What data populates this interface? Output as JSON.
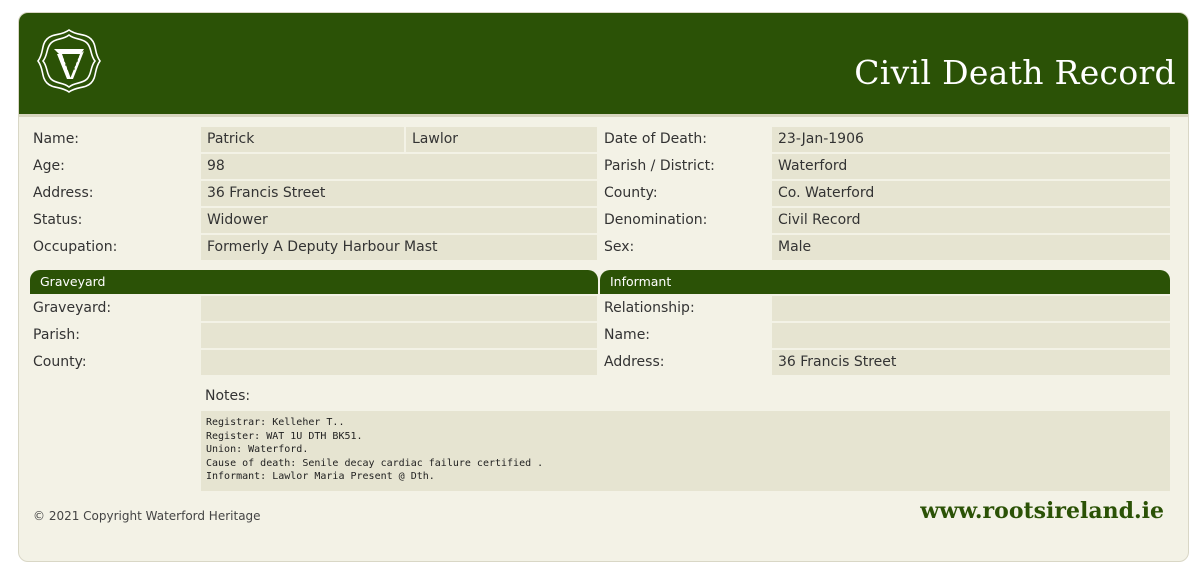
{
  "header": {
    "title": "Civil Death Record",
    "logo_icon": "harp-logo-icon"
  },
  "colors": {
    "brand_green": "#2b5206",
    "cell_bg": "#e6e4d1",
    "card_bg": "#f3f2e6"
  },
  "left_fields": {
    "name_label": "Name:",
    "first_name": "Patrick",
    "surname": "Lawlor",
    "age_label": "Age:",
    "age": "98",
    "address_label": "Address:",
    "address": "36 Francis Street",
    "status_label": "Status:",
    "status": "Widower",
    "occupation_label": "Occupation:",
    "occupation": "Formerly A Deputy Harbour Mast"
  },
  "right_fields": {
    "date_label": "Date of Death:",
    "date": "23-Jan-1906",
    "parish_label": "Parish / District:",
    "parish": "Waterford",
    "county_label": "County:",
    "county": "Co. Waterford",
    "denomination_label": "Denomination:",
    "denomination": "Civil Record",
    "sex_label": "Sex:",
    "sex": "Male"
  },
  "graveyard": {
    "section_title": "Graveyard",
    "graveyard_label": "Graveyard:",
    "graveyard": "",
    "parish_label": "Parish:",
    "parish": "",
    "county_label": "County:",
    "county": ""
  },
  "informant": {
    "section_title": "Informant",
    "relationship_label": "Relationship:",
    "relationship": "",
    "name_label": "Name:",
    "name": "",
    "address_label": "Address:",
    "address": "36 Francis Street"
  },
  "notes": {
    "label": "Notes:",
    "text": "Registrar: Kelleher T..\nRegister: WAT 1U DTH BK51.\nUnion: Waterford.\nCause of death: Senile decay cardiac failure certified .\nInformant: Lawlor Maria Present @ Dth."
  },
  "footer": {
    "copyright": "© 2021 Copyright Waterford Heritage",
    "url": "www.rootsireland.ie"
  }
}
